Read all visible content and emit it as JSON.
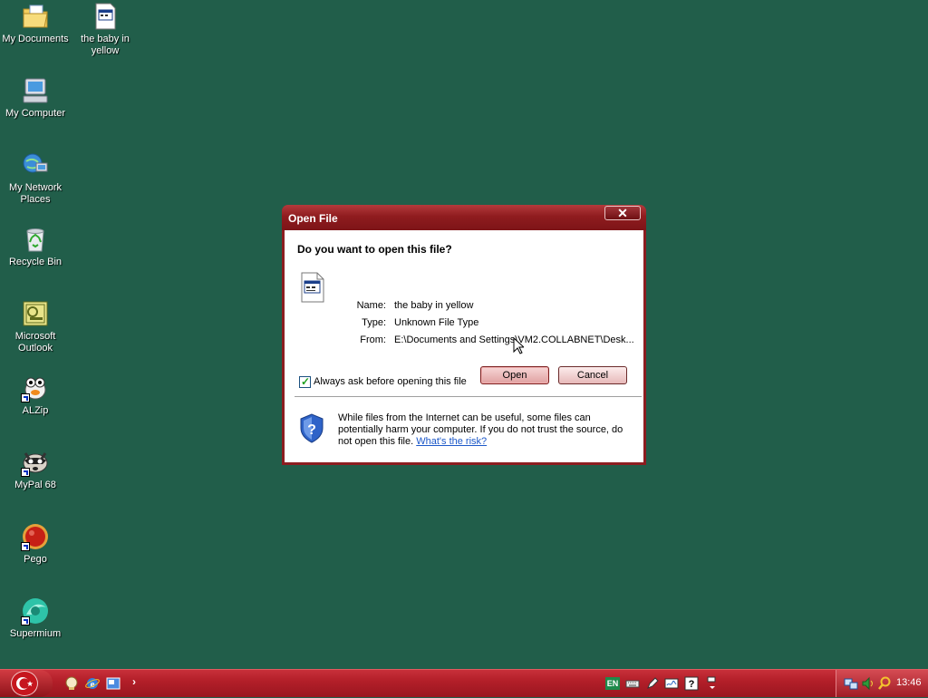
{
  "desktop": {
    "icons": [
      {
        "label": "My Documents",
        "icon": "folder-documents-icon"
      },
      {
        "label": "the baby in yellow",
        "icon": "file-icon"
      },
      {
        "label": "My Computer",
        "icon": "computer-icon"
      },
      {
        "label": "My Network Places",
        "icon": "network-icon"
      },
      {
        "label": "Recycle Bin",
        "icon": "recycle-bin-icon"
      },
      {
        "label": "Microsoft Outlook",
        "icon": "outlook-icon"
      },
      {
        "label": "ALZip",
        "icon": "alzip-icon"
      },
      {
        "label": "MyPal 68",
        "icon": "mypal-icon"
      },
      {
        "label": "Pego",
        "icon": "pego-icon"
      },
      {
        "label": "Supermium",
        "icon": "supermium-icon"
      }
    ]
  },
  "dialog": {
    "title": "Open File",
    "close_label": "✕",
    "question": "Do you want to open this file?",
    "name_label": "Name:",
    "name_value": "the baby in yellow",
    "type_label": "Type:",
    "type_value": "Unknown File Type",
    "from_label": "From:",
    "from_value": "E:\\Documents and Settings\\VM2.COLLABNET\\Desk...",
    "open_label": "Open",
    "cancel_label": "Cancel",
    "checkbox_label": "Always ask before opening this file",
    "checkbox_checked": true,
    "warning_text": "While files from the Internet can be useful, some files can potentially harm your computer. If you do not trust the source, do not open this file.",
    "risk_link": "What's the risk?"
  },
  "taskbar": {
    "quick_launch_chevron": "›",
    "language": "EN",
    "clock": "13:46"
  },
  "colors": {
    "desktop": "#215e4a",
    "titlebar": "#8f1c1f",
    "taskbar": "#b31f29",
    "link": "#1c58c8"
  }
}
